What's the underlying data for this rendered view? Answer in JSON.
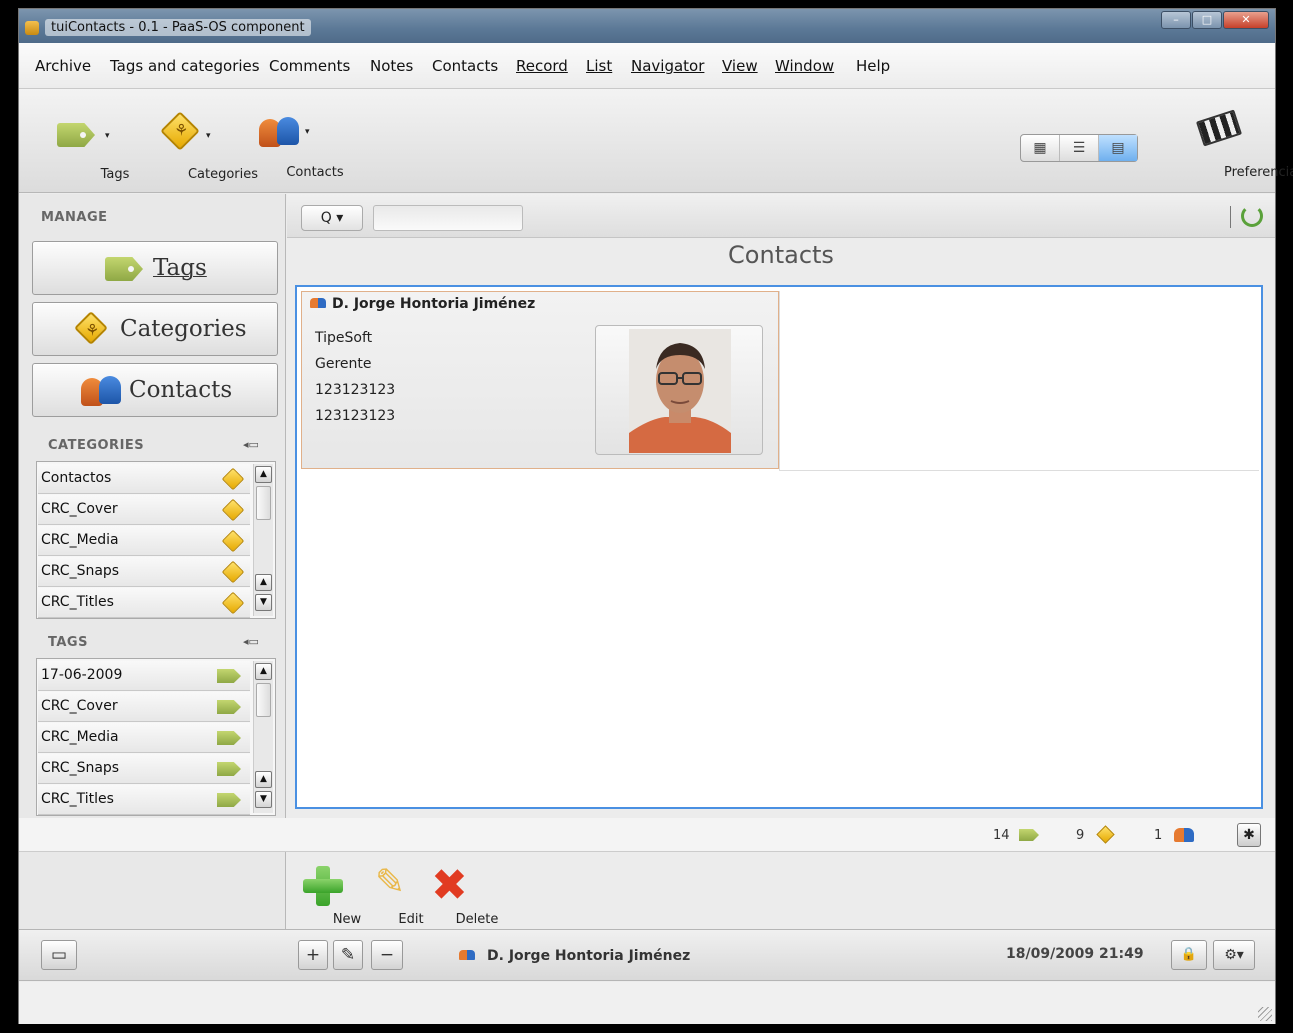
{
  "window": {
    "title": "tuiContacts - 0.1 - PaaS-OS component",
    "controls": {
      "minimize": "–",
      "maximize": "□",
      "close": "✕"
    }
  },
  "menu": [
    "Archive",
    "Tags and categories",
    "Comments",
    "Notes",
    "Contacts",
    "Record",
    "List",
    "Navigator",
    "View",
    "Window",
    "Help"
  ],
  "toolbar": {
    "tags_label": "Tags",
    "categories_label": "Categories",
    "contacts_label": "Contacts",
    "preferences_label": "Preferencias",
    "view_modes": [
      "▦",
      "☰",
      "▤"
    ]
  },
  "sidebar": {
    "manage_label": "MANAGE",
    "manage_buttons": [
      "Tags",
      "Categories",
      "Contacts"
    ],
    "categories_label": "CATEGORIES",
    "categories": [
      "Contactos",
      "CRC_Cover",
      "CRC_Media",
      "CRC_Snaps",
      "CRC_Titles"
    ],
    "tags_label": "TAGS",
    "tags": [
      "17-06-2009",
      "CRC_Cover",
      "CRC_Media",
      "CRC_Snaps",
      "CRC_Titles"
    ]
  },
  "search": {
    "type_label": "Q ▾",
    "value": ""
  },
  "main": {
    "title": "Contacts"
  },
  "contact_card": {
    "name": "D. Jorge Hontoria Jiménez",
    "lines": [
      "TipeSoft",
      "Gerente",
      "123123123",
      "123123123"
    ]
  },
  "status": {
    "tag_count": "14",
    "category_count": "9",
    "contact_count": "1"
  },
  "actions": {
    "new_label": "New",
    "edit_label": "Edit",
    "delete_label": "Delete"
  },
  "bottom_bar": {
    "add": "+",
    "edit": "✎",
    "remove": "−",
    "current_contact": "D. Jorge Hontoria Jiménez",
    "datetime": "18/09/2009 21:49",
    "lock": "🔒",
    "gear": "⚙▾"
  },
  "colors": {
    "selection_border": "#4a90e2",
    "card_border": "#e0b08a",
    "delete_red": "#e13b21",
    "new_green": "#3aa32a"
  }
}
